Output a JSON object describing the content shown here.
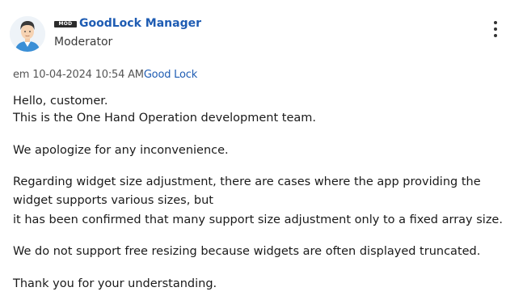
{
  "author": {
    "badge": "MOD",
    "name": "GoodLock Manager",
    "role": "Moderator",
    "avatar_icon": "user-avatar-icon"
  },
  "meta": {
    "prefix": "em",
    "date": "10-04-2024",
    "time": "10:54 AM",
    "board": "Good Lock"
  },
  "body": {
    "greeting": "Hello, customer.",
    "intro": "This is the One Hand Operation development team.",
    "apology": "We apologize for any inconvenience.",
    "detail_line1": "Regarding widget size adjustment, there are cases where the app providing the",
    "detail_line2": "widget supports various sizes, but",
    "detail_line3": "it has been confirmed that many support size adjustment only to a fixed array size.",
    "resize_note": "We do not support free resizing because widgets are often displayed truncated.",
    "closing": "Thank you for your understanding."
  },
  "colors": {
    "link": "#1e5cb3",
    "text": "#1a1a1a",
    "badge_bg": "#2b2b2b"
  },
  "menu_icon": "more-vertical-icon"
}
